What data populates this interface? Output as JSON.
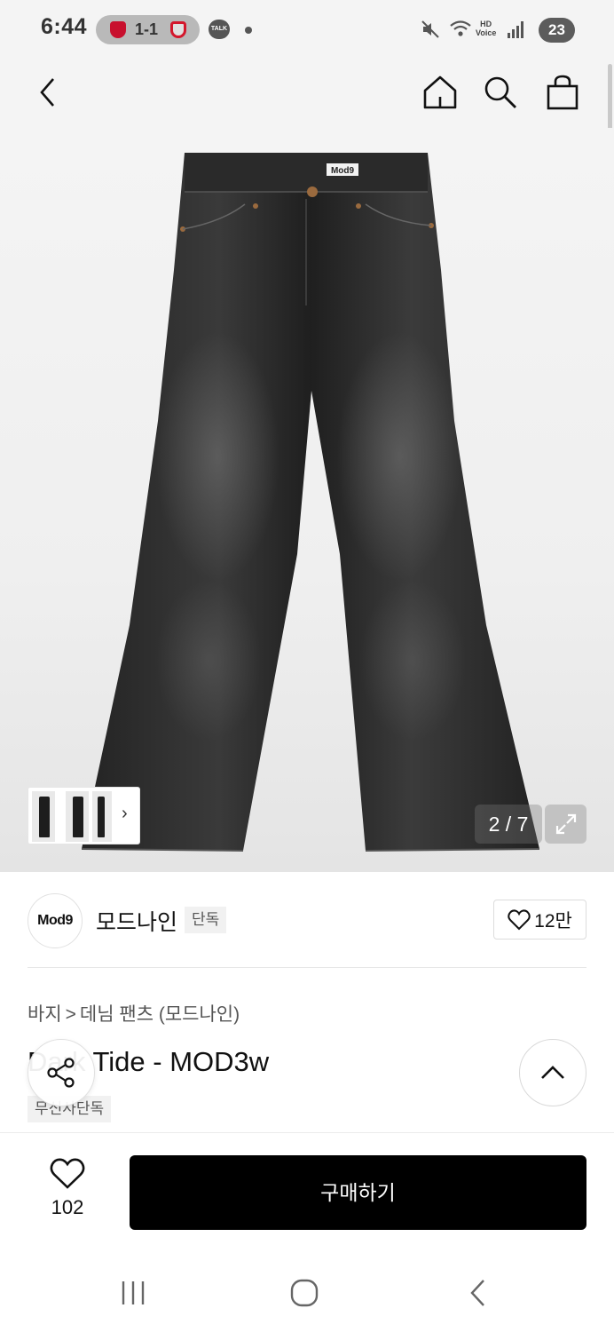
{
  "status_bar": {
    "time": "6:44",
    "score": "1-1",
    "talk_label": "TALK",
    "hd_label": "HD",
    "voice_label": "Voice",
    "battery": "23"
  },
  "header": {
    "icons": [
      "back-icon",
      "home-icon",
      "search-icon",
      "shopping-bag-icon"
    ]
  },
  "gallery": {
    "page_indicator": "2 / 7",
    "brand_patch": "Mod9",
    "current_page": 2,
    "total_pages": 7
  },
  "brand": {
    "logo_text": "Mod9",
    "name": "모드나인",
    "exclusive_tag": "단독",
    "like_count": "12만"
  },
  "product": {
    "breadcrumb": [
      "바지",
      "데님 팬츠 (모드나인)"
    ],
    "breadcrumb_sep": ">",
    "title": "Dark Tide - MOD3w",
    "tag": "무신사단독"
  },
  "purchase_bar": {
    "wish_count": "102",
    "buy_label": "구매하기"
  },
  "colors": {
    "buy_button": "#000000",
    "background": "#f4f4f4"
  }
}
